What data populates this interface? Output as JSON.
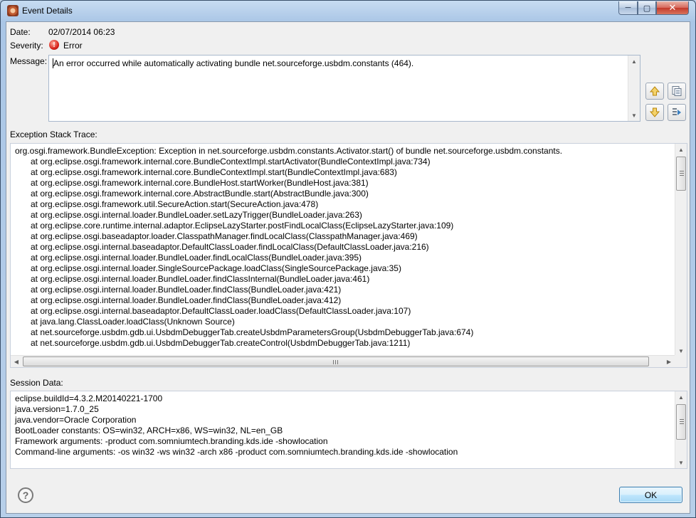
{
  "window": {
    "title": "Event Details"
  },
  "fields": {
    "date_label": "Date:",
    "date_value": "02/07/2014 06:23",
    "severity_label": "Severity:",
    "severity_value": "Error",
    "message_label": "Message:",
    "message_value": "An error occurred while automatically activating bundle net.sourceforge.usbdm.constants (464)."
  },
  "exception": {
    "label": "Exception Stack Trace:",
    "lines": [
      "org.osgi.framework.BundleException: Exception in net.sourceforge.usbdm.constants.Activator.start() of bundle net.sourceforge.usbdm.constants.",
      "at org.eclipse.osgi.framework.internal.core.BundleContextImpl.startActivator(BundleContextImpl.java:734)",
      "at org.eclipse.osgi.framework.internal.core.BundleContextImpl.start(BundleContextImpl.java:683)",
      "at org.eclipse.osgi.framework.internal.core.BundleHost.startWorker(BundleHost.java:381)",
      "at org.eclipse.osgi.framework.internal.core.AbstractBundle.start(AbstractBundle.java:300)",
      "at org.eclipse.osgi.framework.util.SecureAction.start(SecureAction.java:478)",
      "at org.eclipse.osgi.internal.loader.BundleLoader.setLazyTrigger(BundleLoader.java:263)",
      "at org.eclipse.core.runtime.internal.adaptor.EclipseLazyStarter.postFindLocalClass(EclipseLazyStarter.java:109)",
      "at org.eclipse.osgi.baseadaptor.loader.ClasspathManager.findLocalClass(ClasspathManager.java:469)",
      "at org.eclipse.osgi.internal.baseadaptor.DefaultClassLoader.findLocalClass(DefaultClassLoader.java:216)",
      "at org.eclipse.osgi.internal.loader.BundleLoader.findLocalClass(BundleLoader.java:395)",
      "at org.eclipse.osgi.internal.loader.SingleSourcePackage.loadClass(SingleSourcePackage.java:35)",
      "at org.eclipse.osgi.internal.loader.BundleLoader.findClassInternal(BundleLoader.java:461)",
      "at org.eclipse.osgi.internal.loader.BundleLoader.findClass(BundleLoader.java:421)",
      "at org.eclipse.osgi.internal.loader.BundleLoader.findClass(BundleLoader.java:412)",
      "at org.eclipse.osgi.internal.baseadaptor.DefaultClassLoader.loadClass(DefaultClassLoader.java:107)",
      "at java.lang.ClassLoader.loadClass(Unknown Source)",
      "at net.sourceforge.usbdm.gdb.ui.UsbdmDebuggerTab.createUsbdmParametersGroup(UsbdmDebuggerTab.java:674)",
      "at net.sourceforge.usbdm.gdb.ui.UsbdmDebuggerTab.createControl(UsbdmDebuggerTab.java:1211)"
    ]
  },
  "session": {
    "label": "Session Data:",
    "lines": [
      "eclipse.buildId=4.3.2.M20140221-1700",
      "java.version=1.7.0_25",
      "java.vendor=Oracle Corporation",
      "BootLoader constants: OS=win32, ARCH=x86, WS=win32, NL=en_GB",
      "Framework arguments:  -product com.somniumtech.branding.kds.ide -showlocation",
      "Command-line arguments:  -os win32 -ws win32 -arch x86 -product com.somniumtech.branding.kds.ide -showlocation"
    ]
  },
  "buttons": {
    "ok_label": "OK"
  },
  "icons": {
    "app": "eclipse-app-icon",
    "severity": "error-icon",
    "previous": "arrow-up-icon",
    "next": "arrow-down-icon",
    "copy": "copy-icon",
    "filter": "filter-icon",
    "help": "help-icon"
  }
}
